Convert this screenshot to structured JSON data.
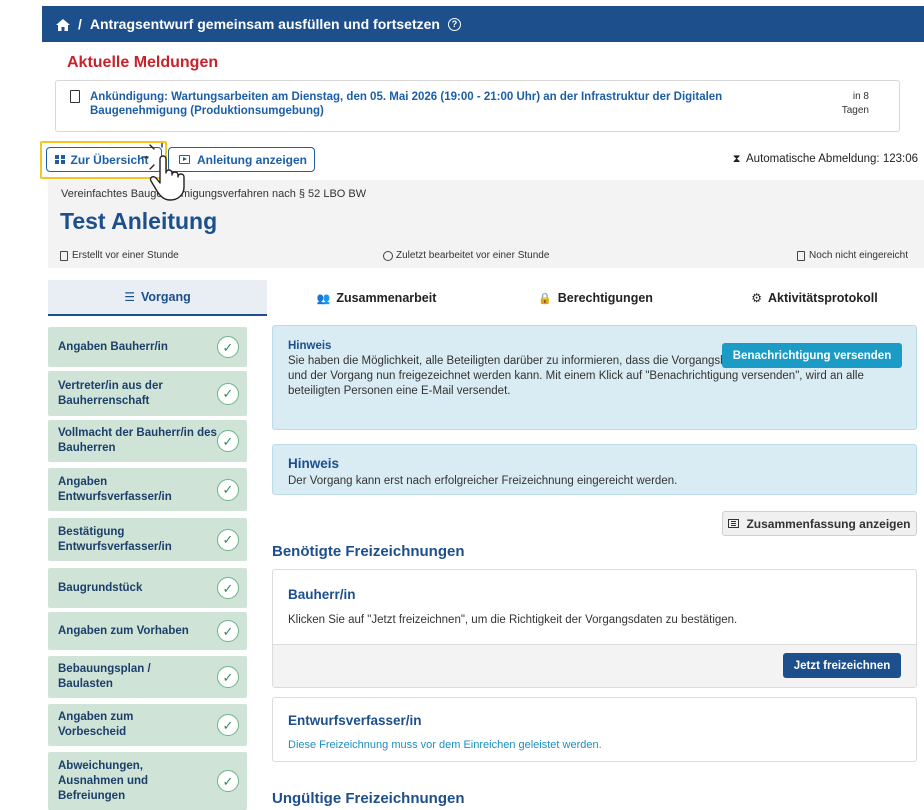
{
  "topbar": {
    "home_icon": "home-icon",
    "separator": "/",
    "title": "Antragsentwurf gemeinsam ausfüllen und fortsetzen",
    "help": "?"
  },
  "messages": {
    "title": "Aktuelle Meldungen",
    "item_icon": "document-icon",
    "item_text": "Ankündigung: Wartungsarbeiten am Dienstag, den 05. Mai 2026 (19:00 - 21:00 Uhr) an der Infrastruktur der Digitalen Baugenehmigung (Produktionsumgebung)",
    "item_time": "in 8 Tagen"
  },
  "toolbar": {
    "overview_label": "Zur Übersicht",
    "guide_label": "Anleitung anzeigen",
    "logout_label": "Automatische Abmeldung: 123:06"
  },
  "header": {
    "procedure": "Vereinfachtes Baugenehmigungsverfahren nach § 52 LBO BW",
    "title": "Test Anleitung",
    "created": "Erstellt vor einer Stunde",
    "edited": "Zuletzt bearbeitet vor einer Stunde",
    "status": "Noch nicht eingereicht"
  },
  "tabs": [
    {
      "label": "Vorgang",
      "icon": "list-icon",
      "symbol": "☰"
    },
    {
      "label": "Zusammenarbeit",
      "icon": "users-icon",
      "symbol": "👥"
    },
    {
      "label": "Berechtigungen",
      "icon": "user-lock-icon",
      "symbol": "🔒"
    },
    {
      "label": "Aktivitätsprotokoll",
      "icon": "gear-icon",
      "symbol": "⚙"
    }
  ],
  "sidebar": {
    "items": [
      {
        "label": "Angaben Bauherr/in"
      },
      {
        "label": "Vertreter/in aus der Bauherrenschaft"
      },
      {
        "label": "Vollmacht der Bauherr/in des Bauherren"
      },
      {
        "label": "Angaben Entwurfsverfasser/in"
      },
      {
        "label": "Bestätigung Entwurfsverfasser/in"
      },
      {
        "label": "Baugrundstück"
      },
      {
        "label": "Angaben zum Vorhaben"
      },
      {
        "label": "Bebauungsplan / Baulasten"
      },
      {
        "label": "Angaben zum Vorbescheid"
      },
      {
        "label": "Abweichungen, Ausnahmen und Befreiungen"
      }
    ],
    "check_symbol": "✓"
  },
  "hint1": {
    "title": "Hinweis",
    "text": "Sie haben die Möglichkeit, alle Beteiligten darüber zu informieren, dass die Vorgangsbearbeitung abgeschlossen ist und der Vorgang nun freigezeichnet werden kann. Mit einem Klick auf \"Benachrichtigung versenden\", wird an alle beteiligten Personen eine E-Mail versendet.",
    "button": "Benachrichtigung versenden"
  },
  "hint2": {
    "title": "Hinweis",
    "text": "Der Vorgang kann erst nach erfolgreicher Freizeichnung eingereicht werden."
  },
  "summary_button": "Zusammenfassung anzeigen",
  "required": {
    "title": "Benötigte Freizeichnungen",
    "card1": {
      "title": "Bauherr/in",
      "text": "Klicken Sie auf \"Jetzt freizeichnen\", um die Richtigkeit der Vorgangsdaten zu bestätigen.",
      "button": "Jetzt freizeichnen"
    },
    "card2": {
      "title": "Entwurfsverfasser/in",
      "text": "Diese Freizeichnung muss vor dem Einreichen geleistet werden."
    }
  },
  "invalid": {
    "title": "Ungültige Freizeichnungen"
  }
}
